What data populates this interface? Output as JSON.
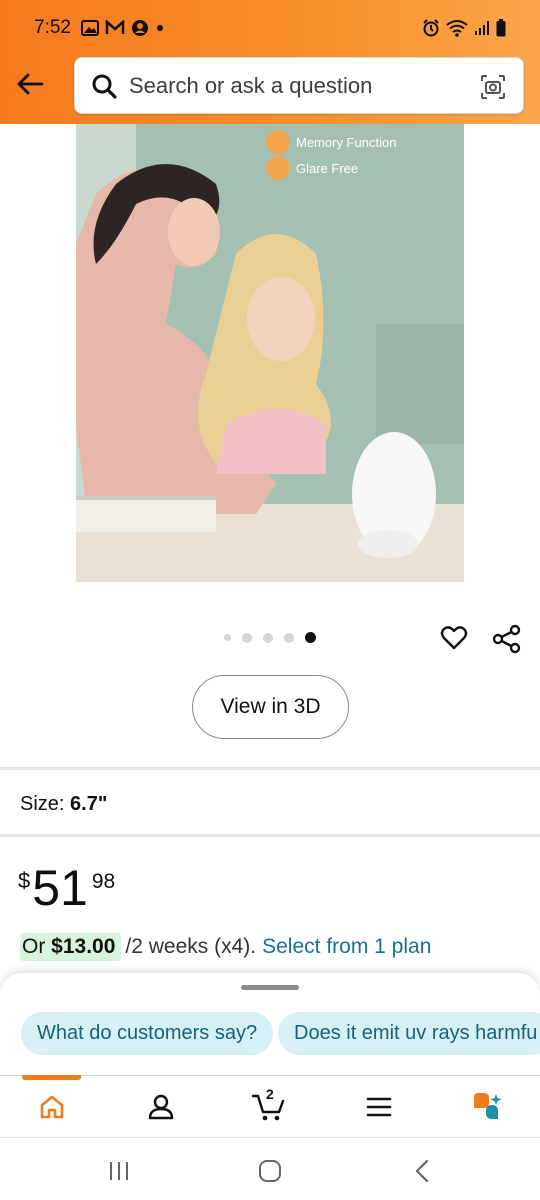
{
  "status_bar": {
    "time": "7:52"
  },
  "header": {
    "search_placeholder": "Search or ask a question"
  },
  "product_image": {
    "features": [
      "Memory Function",
      "Glare Free"
    ],
    "carousel_total": 5,
    "carousel_active": 5
  },
  "actions": {
    "view_3d_label": "View in 3D"
  },
  "size": {
    "label": "Size:",
    "value": "6.7\""
  },
  "price": {
    "symbol": "$",
    "whole": "51",
    "fraction": "98"
  },
  "installment": {
    "or_prefix": "Or",
    "amount": "$13.00",
    "terms": "/2 weeks (x4).",
    "plan_link": "Select from 1 plan"
  },
  "suggestions": [
    "What do customers say?",
    "Does it emit uv rays harmfu"
  ],
  "bottom_nav": {
    "cart_count": "2",
    "items": [
      "home-icon",
      "account-icon",
      "cart-icon",
      "menu-icon",
      "rufus-icon"
    ]
  },
  "colors": {
    "accent": "#f57a1e",
    "link": "#1a6f94",
    "chip_bg": "#d6f0f6",
    "pill_bg": "#d6f4dd"
  }
}
